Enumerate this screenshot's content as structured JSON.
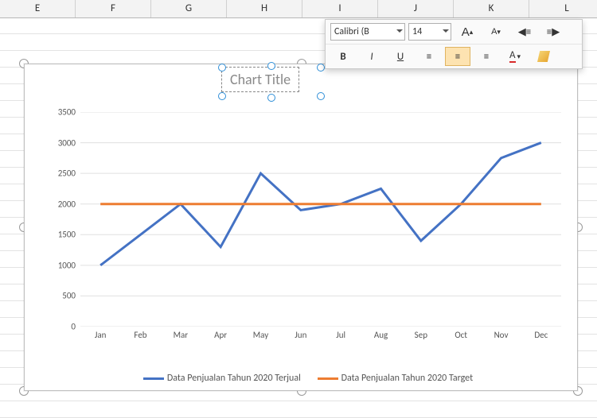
{
  "columns": [
    "E",
    "F",
    "G",
    "H",
    "I",
    "J",
    "K",
    "L"
  ],
  "toolbar": {
    "font_name": "Calibri (B",
    "font_size": "14",
    "grow": "A",
    "shrink": "A",
    "bold": "B",
    "italic": "I",
    "underline": "U",
    "font_color_letter": "A"
  },
  "chart_title_placeholder": "Chart Title",
  "legend": {
    "series1": "Data Penjualan Tahun 2020 Terjual",
    "series2": "Data Penjualan Tahun 2020 Target"
  },
  "chart_data": {
    "type": "line",
    "title": "Chart Title",
    "xlabel": "",
    "ylabel": "",
    "ylim": [
      0,
      3500
    ],
    "yticks": [
      0,
      500,
      1000,
      1500,
      2000,
      2500,
      3000,
      3500
    ],
    "categories": [
      "Jan",
      "Feb",
      "Mar",
      "Apr",
      "May",
      "Jun",
      "Jul",
      "Aug",
      "Sep",
      "Oct",
      "Nov",
      "Dec"
    ],
    "series": [
      {
        "name": "Data Penjualan Tahun 2020 Terjual",
        "color": "#4472c4",
        "values": [
          1000,
          1500,
          2000,
          1300,
          2500,
          1900,
          2000,
          2250,
          1400,
          2000,
          2750,
          3000
        ]
      },
      {
        "name": "Data Penjualan Tahun 2020 Target",
        "color": "#ed7d31",
        "values": [
          2000,
          2000,
          2000,
          2000,
          2000,
          2000,
          2000,
          2000,
          2000,
          2000,
          2000,
          2000
        ]
      }
    ]
  }
}
